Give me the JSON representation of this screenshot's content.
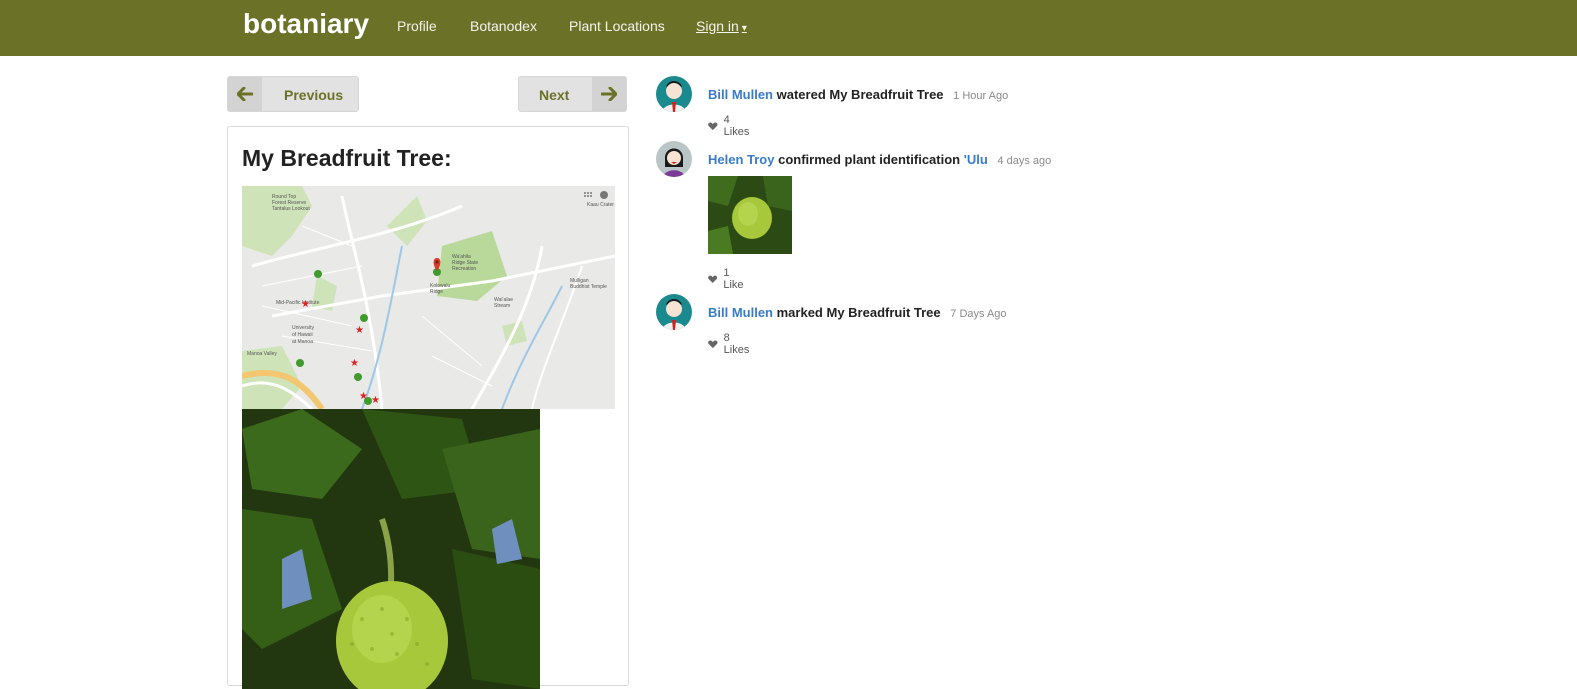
{
  "navbar": {
    "brand": "botaniary",
    "links": [
      "Profile",
      "Botanodex",
      "Plant Locations"
    ],
    "signin": "Sign in",
    "signin_caret": "▾"
  },
  "pager": {
    "previous": "Previous",
    "next": "Next"
  },
  "plant": {
    "title": "My Breadfruit Tree:"
  },
  "map": {
    "labels": [
      "Round Top Forest Reserve",
      "Tantalus Lookout",
      "Mid-Pacific Institute",
      "University of Hawaii at Manoa",
      "Manoa Valley",
      "Wa'ahila Ridge State Recreation Area",
      "Kolowalu Ridge",
      "Waiʻalae Stream",
      "Mulligan Buddhist Temple",
      "Kaau Crater"
    ]
  },
  "feed": [
    {
      "user": "Bill Mullen",
      "action": "watered",
      "target": "My Breadfruit Tree",
      "time": "1 Hour Ago",
      "likes": "4 Likes"
    },
    {
      "user": "Helen Troy",
      "action": "confirmed plant identification",
      "target": "'Ulu",
      "time": "4 days ago",
      "likes": "1 Like"
    },
    {
      "user": "Bill Mullen",
      "action": "marked",
      "target": "My Breadfruit Tree",
      "time": "7 Days Ago",
      "likes": "8 Likes"
    }
  ],
  "colors": {
    "navbar": "#6b7227",
    "link": "#3a7bc8",
    "button_text": "#6b7227"
  }
}
